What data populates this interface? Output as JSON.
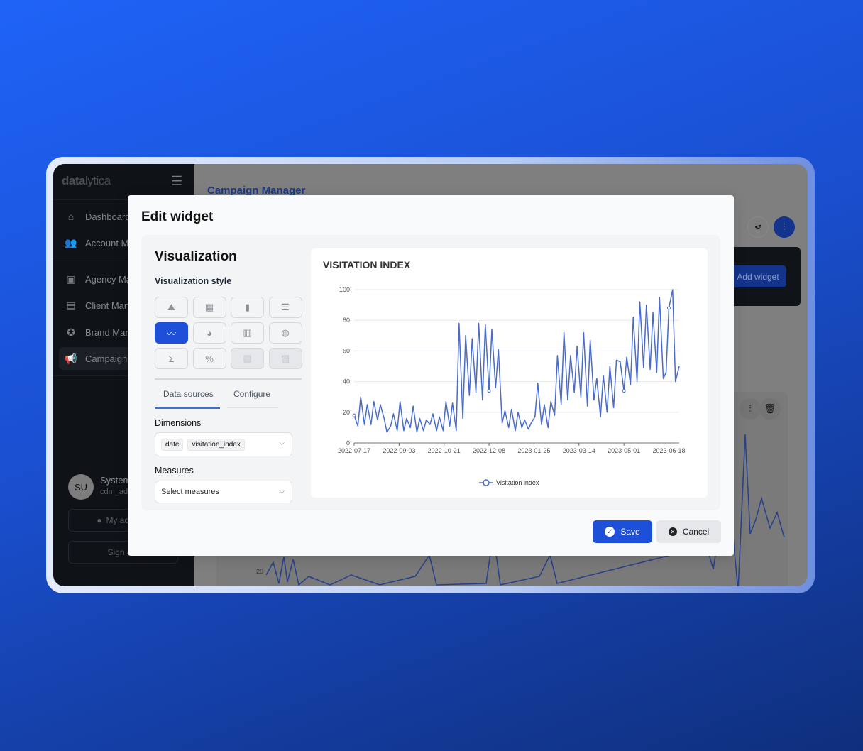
{
  "sidebar": {
    "logo": {
      "bold": "data",
      "light": "lytica"
    },
    "items": [
      {
        "label": "Dashboard",
        "icon": "home-icon"
      },
      {
        "label": "Account Manager",
        "icon": "users-icon"
      },
      {
        "label": "Agency Manager",
        "icon": "presentation-icon"
      },
      {
        "label": "Client Manager",
        "icon": "briefcase-icon"
      },
      {
        "label": "Brand Manager",
        "icon": "award-icon"
      },
      {
        "label": "Campaign Manager",
        "icon": "megaphone-icon",
        "active": true
      }
    ],
    "user": {
      "initials": "SU",
      "name": "System User",
      "handle": "cdm_admin"
    },
    "my_account": "My account",
    "sign_out": "Sign out"
  },
  "main": {
    "title": "Campaign Manager",
    "add_widget": "Add widget",
    "bg_axis_label": "20"
  },
  "modal": {
    "title": "Edit widget",
    "visualization": "Visualization",
    "style_label": "Visualization style",
    "styles": [
      {
        "icon": "area-chart-icon",
        "g": "⛰"
      },
      {
        "icon": "table-icon",
        "g": "▦"
      },
      {
        "icon": "bar-chart-icon",
        "g": "▮"
      },
      {
        "icon": "horizontal-bar-icon",
        "g": "☰"
      },
      {
        "icon": "line-chart-icon",
        "g": "〰",
        "active": true
      },
      {
        "icon": "pie-chart-icon",
        "g": "◕"
      },
      {
        "icon": "pivot-table-icon",
        "g": "▥"
      },
      {
        "icon": "globe-icon",
        "g": "◍"
      },
      {
        "icon": "sigma-icon",
        "g": "Σ"
      },
      {
        "icon": "percent-icon",
        "g": "%"
      },
      {
        "icon": "image-icon",
        "g": "▨",
        "disabled": true
      },
      {
        "icon": "image-icon",
        "g": "▨",
        "disabled": true
      }
    ],
    "tabs": [
      "Data sources",
      "Configure"
    ],
    "active_tab": "Data sources",
    "dimensions_label": "Dimensions",
    "dimensions": [
      "date",
      "visitation_index"
    ],
    "measures_label": "Measures",
    "measures_placeholder": "Select measures",
    "save": "Save",
    "cancel": "Cancel"
  },
  "colors": {
    "accent": "#1d4fd8",
    "series": "#4a6cc9"
  },
  "chart_data": {
    "type": "line",
    "title": "VISITATION INDEX",
    "ylim": [
      0,
      100
    ],
    "yticks": [
      0,
      20,
      40,
      60,
      80,
      100
    ],
    "xticks": [
      "2022-07-17",
      "2022-09-03",
      "2022-10-21",
      "2022-12-08",
      "2023-01-25",
      "2023-03-14",
      "2023-05-01",
      "2023-06-18"
    ],
    "grid": true,
    "legend": "bottom",
    "series": [
      {
        "name": "Visitation index",
        "points": [
          [
            "2022-07-17",
            18
          ],
          [
            "2022-07-21",
            11
          ],
          [
            "2022-07-24",
            30
          ],
          [
            "2022-07-28",
            12
          ],
          [
            "2022-07-31",
            25
          ],
          [
            "2022-08-04",
            12
          ],
          [
            "2022-08-07",
            27
          ],
          [
            "2022-08-11",
            15
          ],
          [
            "2022-08-14",
            25
          ],
          [
            "2022-08-18",
            16
          ],
          [
            "2022-08-21",
            7
          ],
          [
            "2022-08-25",
            11
          ],
          [
            "2022-08-28",
            19
          ],
          [
            "2022-09-01",
            8
          ],
          [
            "2022-09-04",
            27
          ],
          [
            "2022-09-08",
            8
          ],
          [
            "2022-09-11",
            16
          ],
          [
            "2022-09-15",
            10
          ],
          [
            "2022-09-18",
            24
          ],
          [
            "2022-09-22",
            7
          ],
          [
            "2022-09-25",
            16
          ],
          [
            "2022-09-29",
            8
          ],
          [
            "2022-10-02",
            15
          ],
          [
            "2022-10-06",
            12
          ],
          [
            "2022-10-09",
            19
          ],
          [
            "2022-10-13",
            8
          ],
          [
            "2022-10-16",
            17
          ],
          [
            "2022-10-20",
            8
          ],
          [
            "2022-10-23",
            27
          ],
          [
            "2022-10-27",
            11
          ],
          [
            "2022-10-30",
            26
          ],
          [
            "2022-11-03",
            8
          ],
          [
            "2022-11-06",
            78
          ],
          [
            "2022-11-10",
            16
          ],
          [
            "2022-11-13",
            70
          ],
          [
            "2022-11-17",
            31
          ],
          [
            "2022-11-20",
            68
          ],
          [
            "2022-11-24",
            33
          ],
          [
            "2022-11-27",
            78
          ],
          [
            "2022-12-01",
            28
          ],
          [
            "2022-12-04",
            77
          ],
          [
            "2022-12-08",
            34
          ],
          [
            "2022-12-11",
            74
          ],
          [
            "2022-12-15",
            36
          ],
          [
            "2022-12-18",
            61
          ],
          [
            "2022-12-22",
            13
          ],
          [
            "2022-12-25",
            21
          ],
          [
            "2022-12-29",
            10
          ],
          [
            "2023-01-01",
            22
          ],
          [
            "2023-01-05",
            8
          ],
          [
            "2023-01-08",
            20
          ],
          [
            "2023-01-12",
            10
          ],
          [
            "2023-01-15",
            15
          ],
          [
            "2023-01-19",
            9
          ],
          [
            "2023-01-22",
            13
          ],
          [
            "2023-01-26",
            17
          ],
          [
            "2023-01-29",
            39
          ],
          [
            "2023-02-02",
            12
          ],
          [
            "2023-02-05",
            25
          ],
          [
            "2023-02-09",
            10
          ],
          [
            "2023-02-12",
            27
          ],
          [
            "2023-02-16",
            18
          ],
          [
            "2023-02-19",
            57
          ],
          [
            "2023-02-23",
            25
          ],
          [
            "2023-02-26",
            72
          ],
          [
            "2023-03-02",
            28
          ],
          [
            "2023-03-05",
            57
          ],
          [
            "2023-03-09",
            33
          ],
          [
            "2023-03-12",
            63
          ],
          [
            "2023-03-16",
            30
          ],
          [
            "2023-03-19",
            72
          ],
          [
            "2023-03-23",
            24
          ],
          [
            "2023-03-26",
            67
          ],
          [
            "2023-03-30",
            28
          ],
          [
            "2023-04-02",
            42
          ],
          [
            "2023-04-06",
            17
          ],
          [
            "2023-04-09",
            44
          ],
          [
            "2023-04-13",
            20
          ],
          [
            "2023-04-16",
            50
          ],
          [
            "2023-04-20",
            23
          ],
          [
            "2023-04-23",
            54
          ],
          [
            "2023-04-27",
            53
          ],
          [
            "2023-05-01",
            34
          ],
          [
            "2023-05-04",
            56
          ],
          [
            "2023-05-08",
            38
          ],
          [
            "2023-05-11",
            82
          ],
          [
            "2023-05-15",
            40
          ],
          [
            "2023-05-18",
            92
          ],
          [
            "2023-05-22",
            49
          ],
          [
            "2023-05-25",
            90
          ],
          [
            "2023-05-29",
            48
          ],
          [
            "2023-06-01",
            85
          ],
          [
            "2023-06-05",
            46
          ],
          [
            "2023-06-08",
            95
          ],
          [
            "2023-06-12",
            42
          ],
          [
            "2023-06-15",
            46
          ],
          [
            "2023-06-18",
            88
          ],
          [
            "2023-06-22",
            100
          ],
          [
            "2023-06-25",
            40
          ],
          [
            "2023-06-29",
            50
          ]
        ]
      }
    ]
  }
}
